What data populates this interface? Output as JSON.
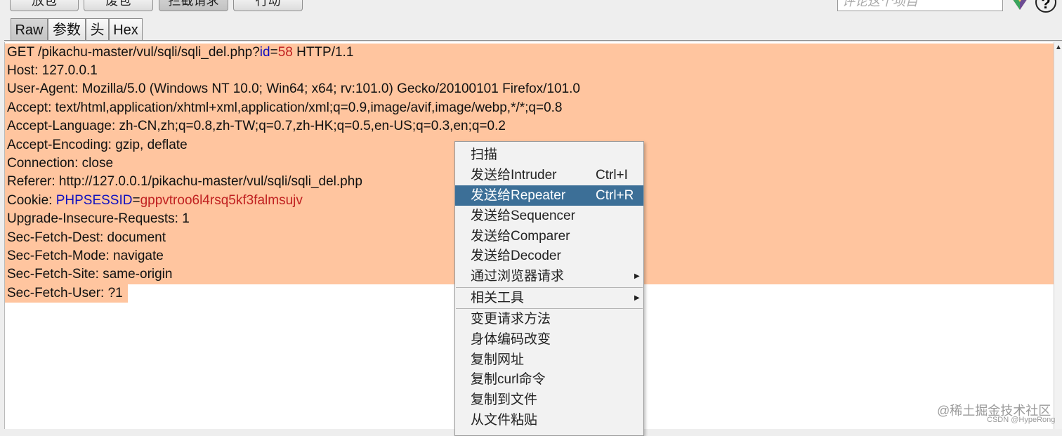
{
  "toolbar": {
    "buttons": [
      "放包",
      "废包",
      "拦截请求",
      "行动"
    ],
    "search_placeholder": "评论这个项目",
    "help_label": "?"
  },
  "tabs": [
    "Raw",
    "参数",
    "头",
    "Hex"
  ],
  "request": {
    "method_line": {
      "prefix": "GET /pikachu-master/vul/sqli/sqli_del.php?",
      "param_key": "id",
      "eq": "=",
      "param_val": "58",
      "suffix": " HTTP/1.1"
    },
    "headers": [
      "Host: 127.0.0.1",
      "User-Agent: Mozilla/5.0 (Windows NT 10.0; Win64; x64; rv:101.0) Gecko/20100101 Firefox/101.0",
      "Accept: text/html,application/xhtml+xml,application/xml;q=0.9,image/avif,image/webp,*/*;q=0.8",
      "Accept-Language: zh-CN,zh;q=0.8,zh-TW;q=0.7,zh-HK;q=0.5,en-US;q=0.3,en;q=0.2",
      "Accept-Encoding: gzip, deflate",
      "Connection: close",
      "Referer: http://127.0.0.1/pikachu-master/vul/sqli/sqli_del.php"
    ],
    "cookie": {
      "prefix": "Cookie: ",
      "key": "PHPSESSID",
      "eq": "=",
      "val": "gppvtroo6l4rsq5kf3falmsujv"
    },
    "headers_after": [
      "Upgrade-Insecure-Requests: 1",
      "Sec-Fetch-Dest: document",
      "Sec-Fetch-Mode: navigate",
      "Sec-Fetch-Site: same-origin",
      "Sec-Fetch-User: ?1"
    ]
  },
  "context_menu": {
    "items": [
      {
        "label": "扫描",
        "shortcut": ""
      },
      {
        "label": "发送给Intruder",
        "shortcut": "Ctrl+I"
      },
      {
        "label": "发送给Repeater",
        "shortcut": "Ctrl+R"
      },
      {
        "label": "发送给Sequencer",
        "shortcut": ""
      },
      {
        "label": "发送给Comparer",
        "shortcut": ""
      },
      {
        "label": "发送给Decoder",
        "shortcut": ""
      },
      {
        "label": "通过浏览器请求",
        "shortcut": ""
      },
      {
        "label": "相关工具",
        "shortcut": ""
      },
      {
        "label": "变更请求方法",
        "shortcut": ""
      },
      {
        "label": "身体编码改变",
        "shortcut": ""
      },
      {
        "label": "复制网址",
        "shortcut": ""
      },
      {
        "label": "复制curl命令",
        "shortcut": ""
      },
      {
        "label": "复制到文件",
        "shortcut": ""
      },
      {
        "label": "从文件粘贴",
        "shortcut": ""
      }
    ]
  },
  "watermark": {
    "line1": "@稀土掘金技术社区",
    "line2": "CSDN @HypeRong"
  },
  "colors": {
    "selection": "#ffc59f",
    "highlight": "#3c6f97",
    "param_key": "#1010c0",
    "param_val": "#c02020"
  }
}
